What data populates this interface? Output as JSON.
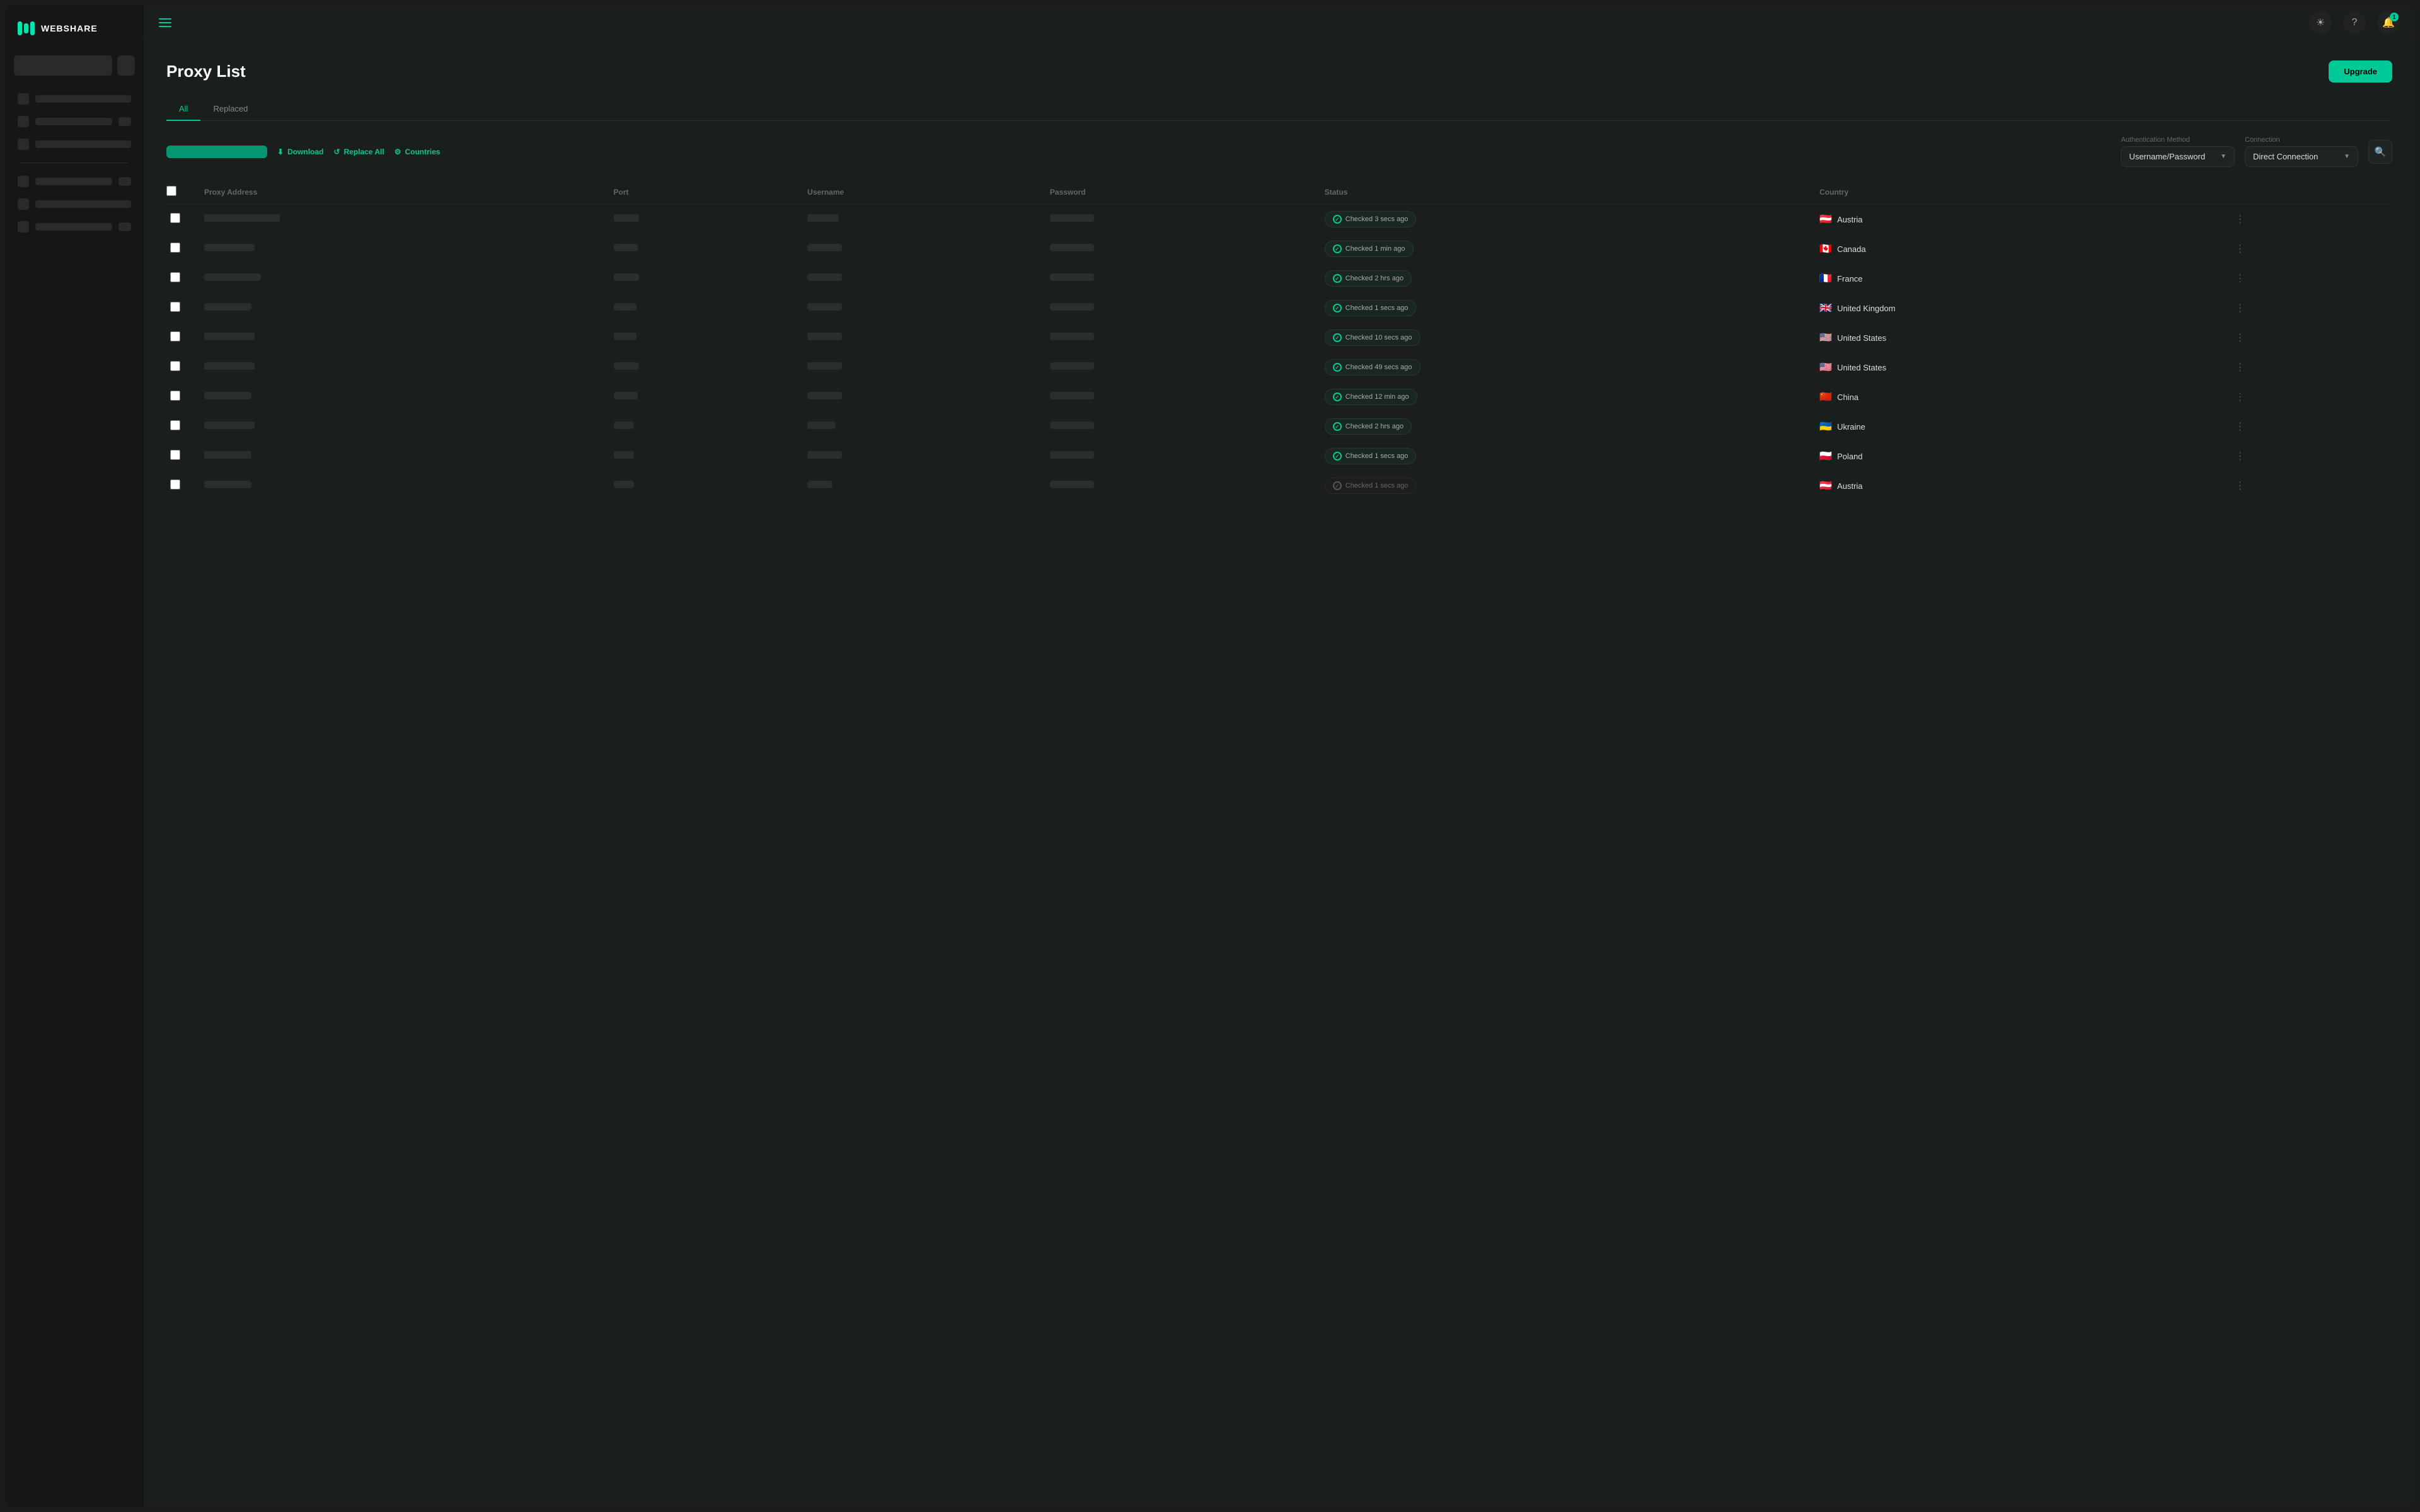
{
  "app": {
    "name": "WEBSHARE"
  },
  "header": {
    "menu_icon": "☰",
    "theme_icon": "☀",
    "help_icon": "?",
    "bell_icon": "🔔",
    "notification_count": "1"
  },
  "page": {
    "title": "Proxy List",
    "upgrade_label": "Upgrade"
  },
  "tabs": [
    {
      "id": "all",
      "label": "All",
      "active": true
    },
    {
      "id": "replaced",
      "label": "Replaced",
      "active": false
    }
  ],
  "toolbar": {
    "download_label": "Download",
    "replace_all_label": "Replace All",
    "countries_label": "Countries",
    "auth_method_label": "Authentication Method",
    "auth_method_value": "Username/Password",
    "connection_label": "Connection",
    "connection_value": "Direct Connection"
  },
  "table": {
    "columns": [
      "Proxy Address",
      "Port",
      "Username",
      "Password",
      "Status",
      "Country"
    ],
    "rows": [
      {
        "status_text": "Checked 3 secs ago",
        "status_active": true,
        "country_name": "Austria",
        "country_flag": "🇦🇹",
        "addr_w": 120,
        "port_w": 40,
        "user_w": 50,
        "pass_w": 70
      },
      {
        "status_text": "Checked 1 min ago",
        "status_active": true,
        "country_name": "Canada",
        "country_flag": "🇨🇦",
        "addr_w": 80,
        "port_w": 38,
        "user_w": 55,
        "pass_w": 70
      },
      {
        "status_text": "Checked 2 hrs ago",
        "status_active": true,
        "country_name": "France",
        "country_flag": "🇫🇷",
        "addr_w": 90,
        "port_w": 40,
        "user_w": 55,
        "pass_w": 70
      },
      {
        "status_text": "Checked 1 secs ago",
        "status_active": true,
        "country_name": "United Kingdom",
        "country_flag": "🇬🇧",
        "addr_w": 75,
        "port_w": 36,
        "user_w": 55,
        "pass_w": 70
      },
      {
        "status_text": "Checked 10 secs ago",
        "status_active": true,
        "country_name": "United States",
        "country_flag": "🇺🇸",
        "addr_w": 80,
        "port_w": 36,
        "user_w": 55,
        "pass_w": 70
      },
      {
        "status_text": "Checked 49 secs ago",
        "status_active": true,
        "country_name": "United States",
        "country_flag": "🇺🇸",
        "addr_w": 80,
        "port_w": 40,
        "user_w": 55,
        "pass_w": 70
      },
      {
        "status_text": "Checked 12 min ago",
        "status_active": true,
        "country_name": "China",
        "country_flag": "🇨🇳",
        "addr_w": 75,
        "port_w": 38,
        "user_w": 55,
        "pass_w": 70
      },
      {
        "status_text": "Checked 2 hrs ago",
        "status_active": true,
        "country_name": "Ukraine",
        "country_flag": "🇺🇦",
        "addr_w": 80,
        "port_w": 32,
        "user_w": 45,
        "pass_w": 70
      },
      {
        "status_text": "Checked 1 secs ago",
        "status_active": true,
        "country_name": "Poland",
        "country_flag": "🇵🇱",
        "addr_w": 75,
        "port_w": 32,
        "user_w": 55,
        "pass_w": 70
      },
      {
        "status_text": "Checked 1 secs ago",
        "status_active": false,
        "country_name": "Austria",
        "country_flag": "🇦🇹",
        "addr_w": 75,
        "port_w": 32,
        "user_w": 40,
        "pass_w": 70
      }
    ]
  },
  "sidebar": {
    "nav_items": [
      {
        "id": "item1",
        "has_badge": true
      },
      {
        "id": "item2",
        "has_badge": false
      },
      {
        "id": "item3",
        "has_badge": true
      },
      {
        "id": "item4",
        "has_badge": false
      },
      {
        "id": "item5",
        "has_badge": true
      },
      {
        "id": "item6",
        "has_badge": false
      },
      {
        "id": "item7",
        "has_badge": true
      }
    ]
  }
}
